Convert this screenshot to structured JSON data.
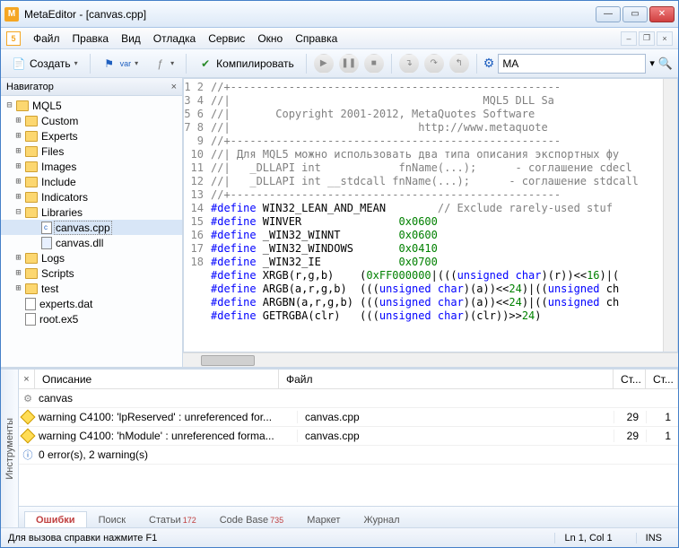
{
  "window": {
    "title": "MetaEditor - [canvas.cpp]"
  },
  "menu": {
    "file": "Файл",
    "edit": "Правка",
    "view": "Вид",
    "debug": "Отладка",
    "service": "Сервис",
    "window": "Окно",
    "help": "Справка"
  },
  "toolbar": {
    "create": "Создать",
    "compile": "Компилировать",
    "search_value": "MA"
  },
  "navigator": {
    "title": "Навигатор",
    "root": "MQL5",
    "items": [
      "Custom",
      "Experts",
      "Files",
      "Images",
      "Include",
      "Indicators",
      "Libraries",
      "Logs",
      "Scripts",
      "test"
    ],
    "lib_children": [
      "canvas.cpp",
      "canvas.dll"
    ],
    "extras": [
      "experts.dat",
      "root.ex5"
    ]
  },
  "code": {
    "lines": [
      {
        "n": 1,
        "html": "<span class='c-cm'>//+---------------------------------------------------</span>"
      },
      {
        "n": 2,
        "html": "<span class='c-cm'>//|                                       MQL5 DLL Sa</span>"
      },
      {
        "n": 3,
        "html": "<span class='c-cm'>//|       Copyright 2001-2012, MetaQuotes Software </span>"
      },
      {
        "n": 4,
        "html": "<span class='c-cm'>//|                             http://www.metaquote</span>"
      },
      {
        "n": 5,
        "html": "<span class='c-cm'>//+---------------------------------------------------</span>"
      },
      {
        "n": 6,
        "html": "<span class='c-cm'>//| Для MQL5 можно использовать два типа описания экспортных фу</span>"
      },
      {
        "n": 7,
        "html": "<span class='c-cm'>//|   _DLLAPI int            fnName(...);      - соглашение cdecl</span>"
      },
      {
        "n": 8,
        "html": "<span class='c-cm'>//|   _DLLAPI int __stdcall fnName(...);      - соглашение stdcall</span>"
      },
      {
        "n": 9,
        "html": "<span class='c-cm'>//+---------------------------------------------------</span>"
      },
      {
        "n": 10,
        "html": "<span class='c-pp'>#define</span> WIN32_LEAN_AND_MEAN        <span class='c-cm'>// Exclude rarely-used stuf</span>"
      },
      {
        "n": 11,
        "html": "<span class='c-pp'>#define</span> WINVER               <span class='c-num'>0x0600</span>"
      },
      {
        "n": 12,
        "html": "<span class='c-pp'>#define</span> _WIN32_WINNT         <span class='c-num'>0x0600</span>"
      },
      {
        "n": 13,
        "html": "<span class='c-pp'>#define</span> _WIN32_WINDOWS       <span class='c-num'>0x0410</span>"
      },
      {
        "n": 14,
        "html": "<span class='c-pp'>#define</span> _WIN32_IE            <span class='c-num'>0x0700</span>"
      },
      {
        "n": 15,
        "html": "<span class='c-pp'>#define</span> XRGB(r,g,b)    (<span class='c-num'>0xFF000000</span>|(((<span class='c-kw'>unsigned</span> <span class='c-kw'>char</span>)(r))&lt;&lt;<span class='c-num'>16</span>)|("
      },
      {
        "n": 16,
        "html": "<span class='c-pp'>#define</span> ARGB(a,r,g,b)  (((<span class='c-kw'>unsigned</span> <span class='c-kw'>char</span>)(a))&lt;&lt;<span class='c-num'>24</span>)|((<span class='c-kw'>unsigned</span> ch"
      },
      {
        "n": 17,
        "html": "<span class='c-pp'>#define</span> ARGBN(a,r,g,b) (((<span class='c-kw'>unsigned</span> <span class='c-kw'>char</span>)(a))&lt;&lt;<span class='c-num'>24</span>)|((<span class='c-kw'>unsigned</span> ch"
      },
      {
        "n": 18,
        "html": "<span class='c-pp'>#define</span> GETRGBA(clr)   (((<span class='c-kw'>unsigned</span> <span class='c-kw'>char</span>)(clr))&gt;&gt;<span class='c-num'>24</span>)"
      }
    ]
  },
  "errors": {
    "header": {
      "desc": "Описание",
      "file": "Файл",
      "line": "Ст...",
      "col": "Ст..."
    },
    "rows": [
      {
        "icon": "gear",
        "desc": "canvas",
        "file": "",
        "line": "",
        "col": ""
      },
      {
        "icon": "warn",
        "desc": "warning C4100: 'lpReserved' : unreferenced for...",
        "file": "canvas.cpp",
        "line": "29",
        "col": "1"
      },
      {
        "icon": "warn",
        "desc": "warning C4100: 'hModule' : unreferenced forma...",
        "file": "canvas.cpp",
        "line": "29",
        "col": "1"
      },
      {
        "icon": "info",
        "desc": "0 error(s), 2 warning(s)",
        "file": "",
        "line": "",
        "col": ""
      }
    ],
    "sidebar_label": "Инструменты"
  },
  "tabs": {
    "errors": "Ошибки",
    "search": "Поиск",
    "articles": "Статьи",
    "articles_badge": "172",
    "codebase": "Code Base",
    "codebase_badge": "735",
    "market": "Маркет",
    "journal": "Журнал"
  },
  "status": {
    "help": "Для вызова справки нажмите F1",
    "pos": "Ln 1, Col 1",
    "ins": "INS"
  }
}
